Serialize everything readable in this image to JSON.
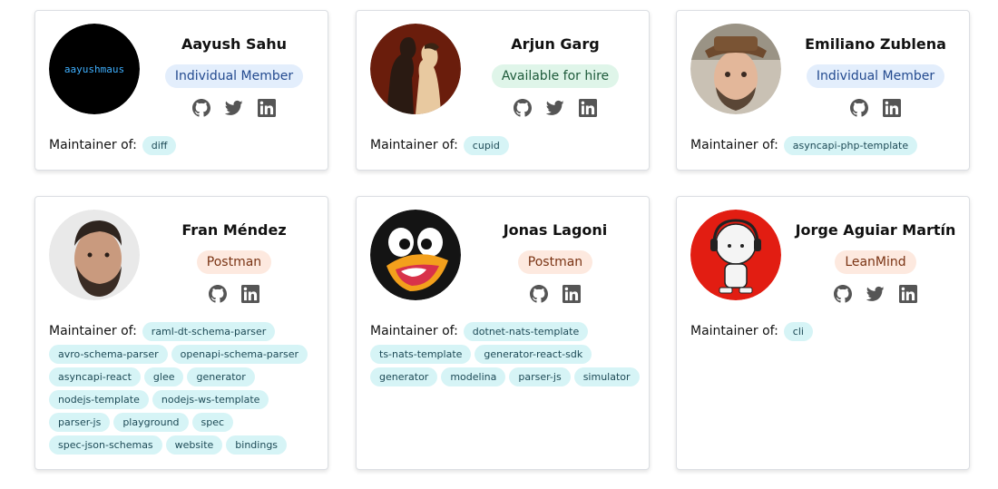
{
  "maintainer_label": "Maintainer of:",
  "cards": [
    {
      "name": "Aayush Sahu",
      "badge": "Individual Member",
      "badge_color": "blue",
      "avatar_text": "aayushmaus",
      "socials": [
        "github-icon",
        "twitter-icon",
        "linkedin-icon"
      ],
      "repos": [
        "diff"
      ]
    },
    {
      "name": "Arjun Garg",
      "badge": "Available for hire",
      "badge_color": "green",
      "socials": [
        "github-icon",
        "twitter-icon",
        "linkedin-icon"
      ],
      "repos": [
        "cupid"
      ]
    },
    {
      "name": "Emiliano Zublena",
      "badge": "Individual Member",
      "badge_color": "blue",
      "socials": [
        "github-icon",
        "linkedin-icon"
      ],
      "repos": [
        "asyncapi-php-template"
      ]
    },
    {
      "name": "Fran Méndez",
      "badge": "Postman",
      "badge_color": "orange",
      "socials": [
        "github-icon",
        "linkedin-icon"
      ],
      "repos": [
        "raml-dt-schema-parser",
        "avro-schema-parser",
        "openapi-schema-parser",
        "asyncapi-react",
        "glee",
        "generator",
        "nodejs-template",
        "nodejs-ws-template",
        "parser-js",
        "playground",
        "spec",
        "spec-json-schemas",
        "website",
        "bindings"
      ]
    },
    {
      "name": "Jonas Lagoni",
      "badge": "Postman",
      "badge_color": "orange",
      "socials": [
        "github-icon",
        "linkedin-icon"
      ],
      "repos": [
        "dotnet-nats-template",
        "ts-nats-template",
        "generator-react-sdk",
        "generator",
        "modelina",
        "parser-js",
        "simulator"
      ]
    },
    {
      "name": "Jorge Aguiar Martín",
      "badge": "LeanMind",
      "badge_color": "orange",
      "socials": [
        "github-icon",
        "twitter-icon",
        "linkedin-icon"
      ],
      "repos": [
        "cli"
      ]
    }
  ]
}
